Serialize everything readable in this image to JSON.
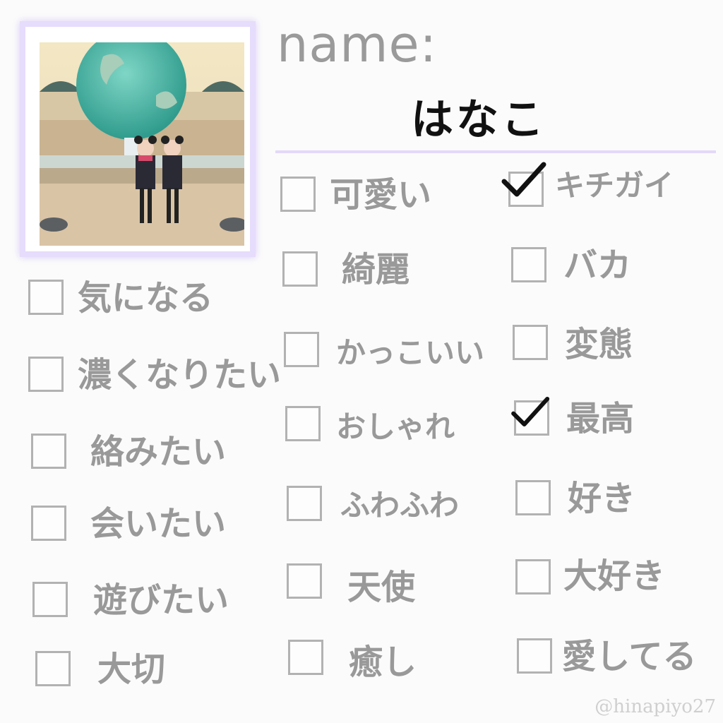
{
  "profile": {
    "name_label": "name:",
    "name_value": "はなこ"
  },
  "checklist_left": [
    {
      "label": "気になる",
      "checked": false
    },
    {
      "label": "濃くなりたい",
      "checked": false
    },
    {
      "label": "絡みたい",
      "checked": false
    },
    {
      "label": "会いたい",
      "checked": false
    },
    {
      "label": "遊びたい",
      "checked": false
    },
    {
      "label": "大切",
      "checked": false
    }
  ],
  "checklist_middle": [
    {
      "label": "可愛い",
      "checked": false
    },
    {
      "label": "綺麗",
      "checked": false
    },
    {
      "label": "かっこいい",
      "checked": false
    },
    {
      "label": "おしゃれ",
      "checked": false
    },
    {
      "label": "ふわふわ",
      "checked": false
    },
    {
      "label": "天使",
      "checked": false
    },
    {
      "label": "癒し",
      "checked": false
    }
  ],
  "checklist_right": [
    {
      "label": "キチガイ",
      "checked": true
    },
    {
      "label": "バカ",
      "checked": false
    },
    {
      "label": "変態",
      "checked": false
    },
    {
      "label": "最高",
      "checked": true
    },
    {
      "label": "好き",
      "checked": false
    },
    {
      "label": "大好き",
      "checked": false
    },
    {
      "label": "愛してる",
      "checked": false
    }
  ],
  "watermark": "@hinapiyo27",
  "colors": {
    "frame": "#e6dcfb",
    "underline": "#e4d8fa",
    "text": "#999999",
    "check": "#111111"
  }
}
